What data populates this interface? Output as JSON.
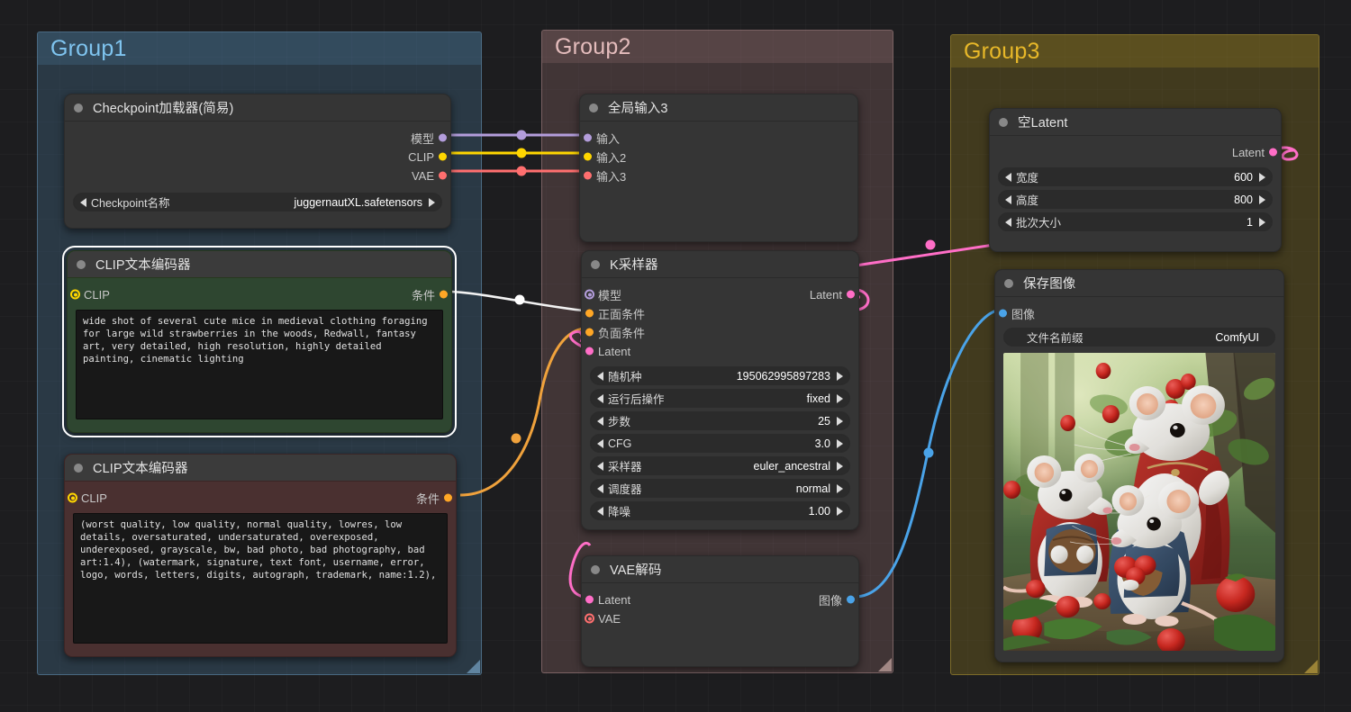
{
  "groups": [
    {
      "id": "group1",
      "title": "Group1",
      "color": "#7fc4ef"
    },
    {
      "id": "group2",
      "title": "Group2",
      "color": "#e4bcbc"
    },
    {
      "id": "group3",
      "title": "Group3",
      "color": "#e8b829"
    }
  ],
  "nodes": {
    "checkpoint_loader": {
      "title": "Checkpoint加载器(简易)",
      "outputs": [
        {
          "label": "模型",
          "color": "#b39ddb"
        },
        {
          "label": "CLIP",
          "color": "#ffd600"
        },
        {
          "label": "VAE",
          "color": "#ff6f6f"
        }
      ],
      "widgets": [
        {
          "label": "Checkpoint名称",
          "value": "juggernautXL.safetensors"
        }
      ]
    },
    "clip_positive": {
      "title": "CLIP文本编码器",
      "selected": true,
      "input": {
        "label": "CLIP",
        "color": "#ffd600"
      },
      "output": {
        "label": "条件",
        "color": "#ffa726"
      },
      "text": "wide shot of several cute mice in medieval clothing foraging for large wild strawberries in the woods, Redwall, fantasy art, very detailed, high resolution, highly detailed painting, cinematic lighting"
    },
    "clip_negative": {
      "title": "CLIP文本编码器",
      "selected": false,
      "input": {
        "label": "CLIP",
        "color": "#ffd600"
      },
      "output": {
        "label": "条件",
        "color": "#ffa726"
      },
      "text": "(worst quality, low quality, normal quality, lowres, low details, oversaturated, undersaturated, overexposed, underexposed, grayscale, bw, bad photo, bad photography, bad art:1.4), (watermark, signature, text font, username, error, logo, words, letters, digits, autograph, trademark, name:1.2),"
    },
    "global_input": {
      "title": "全局输入3",
      "inputs": [
        {
          "label": "输入",
          "color": "#b39ddb"
        },
        {
          "label": "输入2",
          "color": "#ffd600"
        },
        {
          "label": "输入3",
          "color": "#ff6f6f"
        }
      ]
    },
    "ksampler": {
      "title": "K采样器",
      "inputs": [
        {
          "label": "模型",
          "color": "#b39ddb",
          "ring": true
        },
        {
          "label": "正面条件",
          "color": "#ffa726"
        },
        {
          "label": "负面条件",
          "color": "#ffa726"
        },
        {
          "label": "Latent",
          "color": "#ff6ec7"
        }
      ],
      "outputs": [
        {
          "label": "Latent",
          "color": "#ff6ec7"
        }
      ],
      "widgets": [
        {
          "label": "随机种",
          "value": "195062995897283"
        },
        {
          "label": "运行后操作",
          "value": "fixed"
        },
        {
          "label": "步数",
          "value": "25"
        },
        {
          "label": "CFG",
          "value": "3.0"
        },
        {
          "label": "采样器",
          "value": "euler_ancestral"
        },
        {
          "label": "调度器",
          "value": "normal"
        },
        {
          "label": "降噪",
          "value": "1.00"
        }
      ]
    },
    "vae_decode": {
      "title": "VAE解码",
      "inputs": [
        {
          "label": "Latent",
          "color": "#ff6ec7"
        },
        {
          "label": "VAE",
          "color": "#ff6f6f",
          "ring": true
        }
      ],
      "outputs": [
        {
          "label": "图像",
          "color": "#4aa3e8"
        }
      ]
    },
    "empty_latent": {
      "title": "空Latent",
      "outputs": [
        {
          "label": "Latent",
          "color": "#ff6ec7"
        }
      ],
      "widgets": [
        {
          "label": "宽度",
          "value": "600"
        },
        {
          "label": "高度",
          "value": "800"
        },
        {
          "label": "批次大小",
          "value": "1"
        }
      ]
    },
    "save_image": {
      "title": "保存图像",
      "inputs": [
        {
          "label": "图像",
          "color": "#4aa3e8"
        }
      ],
      "widgets": [
        {
          "label": "文件名前缀",
          "value": "ComfyUI"
        }
      ],
      "preview_alt": "三只穿中世纪服装的白鼠在森林中采摘野草莓"
    }
  },
  "link_colors": {
    "model": "#b39ddb",
    "clip": "#ffd600",
    "vae": "#ff6f6f",
    "conditioning_positive": "#ffffff",
    "conditioning_negative": "#ffa726",
    "latent": "#ff6ec7",
    "image": "#4aa3e8"
  }
}
